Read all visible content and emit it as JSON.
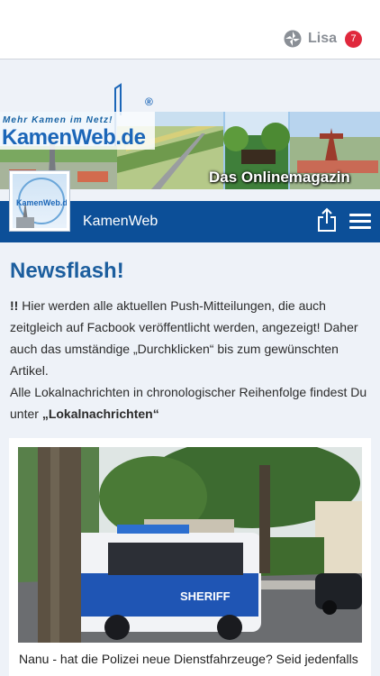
{
  "topbar": {
    "user_name": "Lisa",
    "notification_count": "7",
    "badge_color": "#e0283c"
  },
  "banner": {
    "logo_small": "Mehr Kamen im Netz!",
    "logo_main": "KamenWeb.de",
    "logo_reg": "®",
    "tagline": "Das Onlinemagazin"
  },
  "navbar": {
    "title": "KamenWeb",
    "color": "#0c4f98"
  },
  "avatar": {
    "text": "KamenWeb.de"
  },
  "main": {
    "headline": "Newsflash!",
    "intro_bang": "!!",
    "intro_line1": " Hier werden alle aktuellen Push-Mitteilungen, die auch zeitgleich auf Facbook veröffentlicht werden, angezeigt! Daher auch das umständige „Durchklicken“ bis zum gewünschten Artikel.",
    "intro_line2": "Alle Lokalnachrichten in chronologischer Reihenfolge findest Du unter ",
    "intro_link": "„Lokalnachrichten“"
  },
  "card": {
    "caption": "Nanu - hat die Polizei neue Dienstfahrzeuge? Seid jedenfalls",
    "van_label": "SHERIFF"
  }
}
